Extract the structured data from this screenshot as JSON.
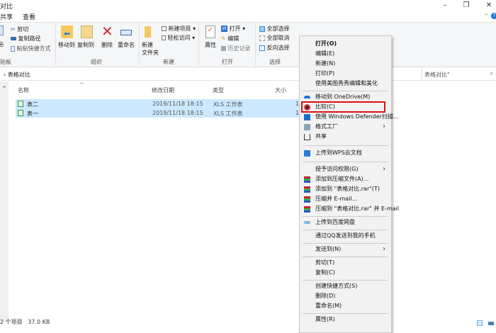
{
  "window": {
    "title": "对比",
    "minimize": "–",
    "restore": "❐",
    "close": "✕",
    "collapse": "^",
    "help": "?"
  },
  "tabs": [
    "共享",
    "查看"
  ],
  "ribbon": {
    "clipboard": {
      "paste": "贴",
      "cut": "剪切",
      "copy_path": "复制路径",
      "paste_shortcut": "粘贴快捷方式",
      "label": "贴板"
    },
    "organize": {
      "move_to": "移动到",
      "copy_to": "复制到",
      "delete": "删除",
      "rename": "重命名",
      "label": "组织"
    },
    "new": {
      "new_folder": "新建\n文件夹",
      "new_item": "新建项目 ▾",
      "easy_access": "轻松访问 ▾",
      "label": "新建"
    },
    "open": {
      "properties": "属性",
      "open": "打开 ▾",
      "edit": "编辑",
      "history": "历史记录",
      "label": "打开"
    },
    "select": {
      "select_all": "全部选择",
      "select_none": "全部取消",
      "invert": "反向选择",
      "label": "选择"
    }
  },
  "address": {
    "path": "表格对比",
    "search_placeholder": "表格对比\""
  },
  "columns": {
    "name": "名称",
    "date": "修改日期",
    "type": "类型",
    "size": "大小"
  },
  "files": [
    {
      "name": "表二",
      "date": "2019/11/18 18:15",
      "type": "XLS 工作表",
      "size": "1"
    },
    {
      "name": "表一",
      "date": "2019/11/18 18:15",
      "type": "XLS 工作表",
      "size": "1"
    }
  ],
  "status": "2 个项目   37.0 KB",
  "menu": {
    "open": "打开(O)",
    "edit": "编辑(E)",
    "new": "新建(N)",
    "print": "打印(P)",
    "meitu": "使用美图秀秀编辑和美化",
    "onedrive": "移动到 OneDrive(M)",
    "compare": "比较(C)",
    "defender": "使用 Windows Defender扫描...",
    "format_factory": "格式工厂",
    "share": "共享",
    "wps": "上传到WPS云文档",
    "grant": "授予访问权限(G)",
    "add_archive": "添加到压缩文件(A)...",
    "add_rar": "添加到 \"表格对比.rar\"(T)",
    "compress_email": "压缩并 E-mail...",
    "compress_rar_email": "压缩到 \"表格对比.rar\" 并 E-mail",
    "baidu": "上传到百度网盘",
    "qq": "通过QQ发送到我的手机",
    "send_to": "发送到(N)",
    "cut": "剪切(T)",
    "copy": "复制(C)",
    "shortcut": "创建快捷方式(S)",
    "delete": "删除(D)",
    "rename": "重命名(M)",
    "properties": "属性(R)"
  },
  "colors": {
    "selection": "#cce8ff",
    "highlight_box": "#dd1111",
    "menu_bg": "#f2f2f2"
  }
}
